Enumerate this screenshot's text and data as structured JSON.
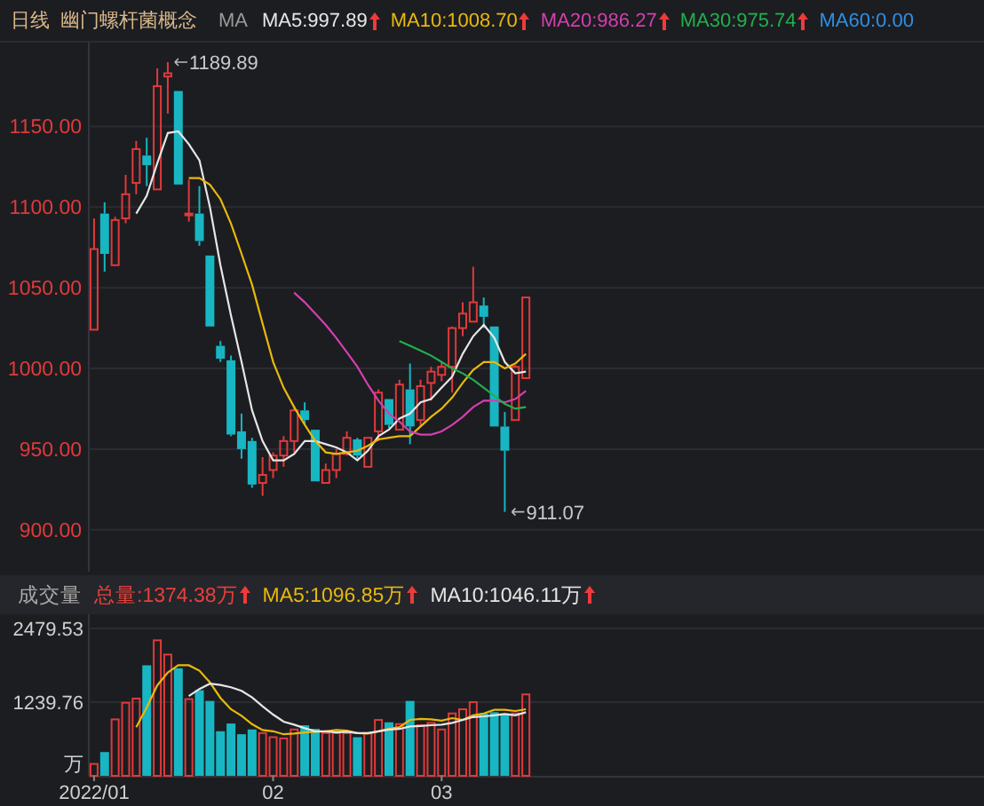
{
  "header": {
    "period": "日线",
    "name": "幽门螺杆菌概念",
    "indicator": "MA",
    "ma": [
      {
        "label": "MA5:997.89",
        "color": "#e6e6e6",
        "rising": true
      },
      {
        "label": "MA10:1008.70",
        "color": "#e8b90c",
        "rising": true
      },
      {
        "label": "MA20:986.27",
        "color": "#d43fae",
        "rising": true
      },
      {
        "label": "MA30:975.74",
        "color": "#20b04c",
        "rising": true
      },
      {
        "label": "MA60:0.00",
        "color": "#2f8fe4"
      }
    ]
  },
  "price_chart": {
    "max_label": "1189.89",
    "min_label": "911.07",
    "chart_data": {
      "type": "candlestick",
      "grid": true,
      "ylim": [
        874,
        1202
      ],
      "categories": [
        null,
        null,
        null,
        null,
        null,
        null,
        null,
        null,
        null,
        null,
        null,
        null,
        null,
        null,
        null,
        null,
        null,
        null,
        null,
        null,
        null,
        null,
        null,
        null,
        null,
        null,
        null,
        null,
        null,
        null,
        null,
        null,
        null,
        null,
        null,
        null,
        null,
        null,
        null,
        null,
        null,
        null,
        null,
        null,
        null,
        null,
        null,
        null,
        null,
        null,
        null,
        null,
        null,
        null,
        null,
        null,
        null,
        null,
        null,
        null,
        null,
        null,
        null,
        null,
        null,
        null,
        null,
        null,
        null,
        null,
        null,
        null,
        null,
        null,
        null,
        null,
        null,
        null,
        null,
        null,
        null,
        null,
        null,
        null,
        null
      ],
      "yticks": [
        {
          "value": 1150,
          "label": "1150.00"
        },
        {
          "value": 1100,
          "label": "1100.00"
        },
        {
          "value": 1050,
          "label": "1050.00"
        },
        {
          "value": 1000,
          "label": "1000.00"
        },
        {
          "value": 950,
          "label": "950.00"
        },
        {
          "value": 900,
          "label": "900.00"
        }
      ],
      "ohlc": [
        [
          1024,
          1093,
          1024,
          1074
        ],
        [
          1096,
          1103,
          1060,
          1071
        ],
        [
          1064,
          1094,
          1064,
          1092
        ],
        [
          1093,
          1120,
          1090,
          1108
        ],
        [
          1115,
          1141,
          1108,
          1136
        ],
        [
          1132,
          1143,
          1113,
          1126
        ],
        [
          1111,
          1186,
          1111,
          1175
        ],
        [
          1181,
          1189.89,
          1158,
          1183
        ],
        [
          1172,
          1172,
          1114,
          1114
        ],
        [
          1095,
          1117,
          1091,
          1096
        ],
        [
          1096,
          1113,
          1076,
          1079
        ],
        [
          1070,
          1070,
          1026,
          1026
        ],
        [
          1014,
          1017,
          1004,
          1006
        ],
        [
          1005,
          1008,
          958,
          959
        ],
        [
          961,
          972,
          944,
          950
        ],
        [
          955,
          957,
          926,
          928
        ],
        [
          929,
          945,
          921,
          934
        ],
        [
          937,
          948,
          932,
          946
        ],
        [
          946,
          958,
          939,
          955
        ],
        [
          955,
          977,
          948,
          974
        ],
        [
          974,
          979,
          965,
          968
        ],
        [
          962,
          962,
          930,
          930
        ],
        [
          929,
          941,
          929,
          937
        ],
        [
          937,
          950,
          932,
          947
        ],
        [
          947,
          961,
          946,
          957
        ],
        [
          956,
          957,
          944,
          946
        ],
        [
          939,
          957,
          939,
          957
        ],
        [
          961,
          987,
          955,
          985
        ],
        [
          981,
          981,
          963,
          965
        ],
        [
          962,
          993,
          962,
          990
        ],
        [
          987,
          1003,
          953,
          964
        ],
        [
          968,
          993,
          964,
          989
        ],
        [
          991,
          1001,
          980,
          998
        ],
        [
          996,
          1004,
          992,
          1001
        ],
        [
          1001,
          1026,
          985,
          1025
        ],
        [
          1025,
          1041,
          1020,
          1034
        ],
        [
          1029,
          1063,
          1029,
          1041
        ],
        [
          1039,
          1044,
          1025,
          1032
        ],
        [
          1026,
          1026,
          964,
          964
        ],
        [
          964,
          973,
          911.07,
          949
        ],
        [
          968,
          1002,
          968,
          1001
        ],
        [
          994,
          1044,
          994,
          1044
        ],
        null,
        null,
        null,
        null,
        null,
        null,
        null,
        null,
        null,
        null,
        null,
        null,
        null,
        null,
        null,
        null,
        null,
        null,
        null,
        null,
        null,
        null,
        null,
        null,
        null,
        null,
        null,
        null,
        null,
        null,
        null,
        null,
        null,
        null,
        null,
        null,
        null,
        null,
        null,
        null,
        null,
        null,
        null
      ],
      "series": [
        {
          "type": "line",
          "color": "#e6e6e6",
          "values": [
            null,
            null,
            null,
            null,
            1096,
            1107,
            1127,
            1146,
            1147,
            1139,
            1129,
            1100,
            1064,
            1033,
            1004,
            974,
            955,
            943,
            943,
            947,
            955,
            955,
            953,
            951,
            948,
            943,
            949,
            958,
            962,
            969,
            972,
            979,
            981,
            988,
            995,
            1009,
            1020,
            1027,
            1019,
            1004,
            997,
            998,
            null,
            null,
            null,
            null,
            null,
            null,
            null,
            null,
            null,
            null,
            null,
            null,
            null,
            null,
            null,
            null,
            null,
            null,
            null,
            null,
            null,
            null,
            null,
            null,
            null,
            null,
            null,
            null,
            null,
            null,
            null,
            null,
            null,
            null,
            null,
            null,
            null,
            null,
            null,
            null,
            null,
            null,
            null
          ]
        },
        {
          "type": "line",
          "color": "#e8b90c",
          "values": [
            null,
            null,
            null,
            null,
            null,
            null,
            null,
            null,
            null,
            1118,
            1118,
            1114,
            1105,
            1090,
            1071,
            1052,
            1028,
            1004,
            988,
            976,
            965,
            955,
            948,
            947,
            948,
            949,
            952,
            956,
            957,
            958,
            958,
            964,
            970,
            975,
            982,
            991,
            999,
            1004,
            1004,
            1000,
            1003,
            1009,
            null,
            null,
            null,
            null,
            null,
            null,
            null,
            null,
            null,
            null,
            null,
            null,
            null,
            null,
            null,
            null,
            null,
            null,
            null,
            null,
            null,
            null,
            null,
            null,
            null,
            null,
            null,
            null,
            null,
            null,
            null,
            null,
            null,
            null,
            null,
            null,
            null,
            null,
            null,
            null,
            null,
            null,
            null
          ]
        },
        {
          "type": "line",
          "color": "#d43fae",
          "values": [
            null,
            null,
            null,
            null,
            null,
            null,
            null,
            null,
            null,
            null,
            null,
            null,
            null,
            null,
            null,
            null,
            null,
            null,
            null,
            1047,
            1041,
            1034,
            1027,
            1019,
            1010,
            1001,
            990,
            980,
            972,
            967,
            961,
            959,
            959,
            961,
            965,
            970,
            976,
            980,
            980,
            979,
            981,
            986,
            null,
            null,
            null,
            null,
            null,
            null,
            null,
            null,
            null,
            null,
            null,
            null,
            null,
            null,
            null,
            null,
            null,
            null,
            null,
            null,
            null,
            null,
            null,
            null,
            null,
            null,
            null,
            null,
            null,
            null,
            null,
            null,
            null,
            null,
            null,
            null,
            null,
            null,
            null,
            null,
            null,
            null,
            null
          ]
        },
        {
          "type": "line",
          "color": "#20b04c",
          "values": [
            null,
            null,
            null,
            null,
            null,
            null,
            null,
            null,
            null,
            null,
            null,
            null,
            null,
            null,
            null,
            null,
            null,
            null,
            null,
            null,
            null,
            null,
            null,
            null,
            null,
            null,
            null,
            null,
            null,
            1017,
            1014,
            1011,
            1008,
            1004,
            1000,
            997,
            993,
            988,
            983,
            978,
            975,
            976,
            null,
            null,
            null,
            null,
            null,
            null,
            null,
            null,
            null,
            null,
            null,
            null,
            null,
            null,
            null,
            null,
            null,
            null,
            null,
            null,
            null,
            null,
            null,
            null,
            null,
            null,
            null,
            null,
            null,
            null,
            null,
            null,
            null,
            null,
            null,
            null,
            null,
            null,
            null,
            null,
            null,
            null,
            null
          ]
        }
      ]
    }
  },
  "volume": {
    "title": "成交量",
    "stats": [
      {
        "label": "总量:1374.38万",
        "color": "#e8403a",
        "rising": true
      },
      {
        "label": "MA5:1096.85万",
        "color": "#e8b90c",
        "rising": true
      },
      {
        "label": "MA10:1046.11万",
        "color": "#e6e6e6",
        "rising": true
      }
    ],
    "chart_data": {
      "type": "bar",
      "grid": true,
      "ylabel": "万",
      "ylim": [
        0,
        2479.53
      ],
      "yticks": [
        1239.76,
        2479.53
      ],
      "categories": [
        "2022/01",
        null,
        null,
        null,
        null,
        null,
        null,
        null,
        null,
        null,
        null,
        null,
        null,
        null,
        null,
        null,
        null,
        "02",
        null,
        null,
        null,
        null,
        null,
        null,
        null,
        null,
        null,
        null,
        null,
        null,
        null,
        null,
        null,
        "03",
        null,
        null,
        null,
        null,
        null,
        null,
        null,
        null
      ],
      "series": [
        {
          "color": "#e03a3a",
          "values": [
            200,
            null,
            950,
            1230,
            1300,
            null,
            2280,
            2040,
            null,
            1290,
            null,
            null,
            null,
            null,
            null,
            null,
            720,
            650,
            630,
            780,
            null,
            null,
            720,
            720,
            720,
            null,
            720,
            940,
            null,
            870,
            null,
            850,
            890,
            780,
            1050,
            1120,
            1240,
            null,
            null,
            null,
            1050,
            1370
          ]
        },
        {
          "color": "#17b6c2",
          "values": [
            null,
            400,
            null,
            null,
            null,
            1860,
            null,
            null,
            1810,
            null,
            1440,
            1260,
            750,
            880,
            700,
            780,
            null,
            null,
            null,
            null,
            850,
            790,
            null,
            null,
            null,
            650,
            null,
            null,
            900,
            null,
            1260,
            null,
            null,
            null,
            null,
            null,
            null,
            1050,
            1070,
            1050,
            null,
            null
          ]
        },
        {
          "type": "line",
          "color": "#e8b90c",
          "values": [
            null,
            null,
            null,
            null,
            820,
            1150,
            1520,
            1740,
            1860,
            1860,
            1770,
            1570,
            1310,
            1120,
            1010,
            870,
            770,
            750,
            700,
            710,
            730,
            740,
            750,
            770,
            760,
            720,
            710,
            750,
            790,
            820,
            940,
            960,
            950,
            930,
            970,
            940,
            1020,
            1050,
            1110,
            1110,
            1090,
            1120
          ]
        },
        {
          "type": "line",
          "color": "#e6e6e6",
          "values": [
            null,
            null,
            null,
            null,
            null,
            null,
            null,
            null,
            null,
            1340,
            1460,
            1550,
            1530,
            1490,
            1430,
            1320,
            1170,
            1030,
            910,
            860,
            800,
            750,
            750,
            730,
            740,
            720,
            720,
            750,
            780,
            790,
            830,
            840,
            850,
            860,
            890,
            940,
            990,
            1000,
            1020,
            1040,
            1020,
            1070
          ]
        }
      ]
    }
  }
}
